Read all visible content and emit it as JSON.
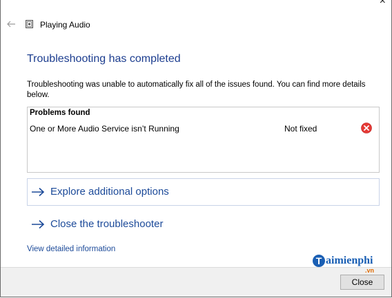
{
  "window": {
    "title": "Playing Audio",
    "close_glyph": "×"
  },
  "main": {
    "heading": "Troubleshooting has completed",
    "description": "Troubleshooting was unable to automatically fix all of the issues found. You can find more details below."
  },
  "problems": {
    "header": "Problems found",
    "items": [
      {
        "name": "One or More Audio Service isn’t Running",
        "status": "Not fixed",
        "status_icon": "error-icon",
        "status_color": "#e53935"
      }
    ]
  },
  "options": {
    "explore_label": "Explore additional options",
    "close_label": "Close the troubleshooter"
  },
  "links": {
    "detailed_info": "View detailed information"
  },
  "footer": {
    "close_button": "Close"
  },
  "watermark": {
    "text": "aimienphi",
    "t": "T",
    "suffix": ".vn"
  },
  "colors": {
    "heading": "#1c3d8f",
    "link": "#1c4a99",
    "error": "#e53935"
  }
}
